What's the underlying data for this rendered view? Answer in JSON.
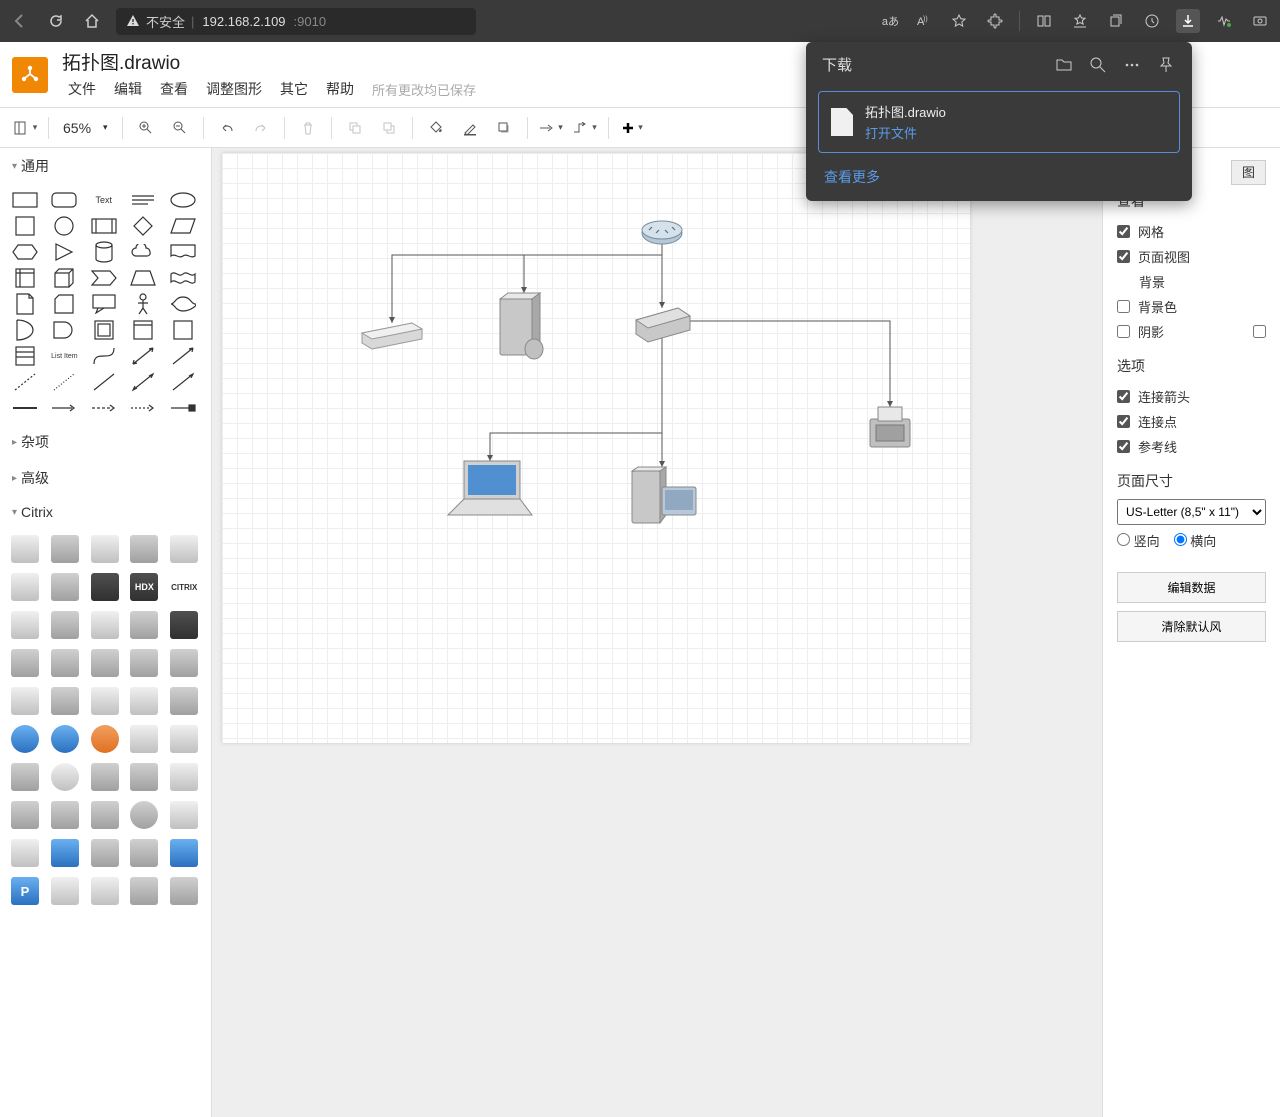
{
  "browser": {
    "insecure_label": "不安全",
    "url_host": "192.168.2.109",
    "url_port": ":9010",
    "lang_indicator": "aあ"
  },
  "app": {
    "doc_title": "拓扑图.drawio",
    "menus": [
      "文件",
      "编辑",
      "查看",
      "调整图形",
      "其它",
      "帮助"
    ],
    "save_status": "所有更改均已保存"
  },
  "toolbar": {
    "zoom_value": "65%"
  },
  "sidebar_left": {
    "categories": [
      "通用",
      "杂项",
      "高级",
      "Citrix"
    ]
  },
  "right_panel": {
    "tab_label": "图",
    "view_title": "查看",
    "checks_view": [
      {
        "label": "网格",
        "checked": true
      },
      {
        "label": "页面视图",
        "checked": true
      }
    ],
    "bg_label": "背景",
    "checks_bg": [
      {
        "label": "背景色",
        "checked": false
      },
      {
        "label": "阴影",
        "checked": false
      }
    ],
    "options_title": "选项",
    "checks_options": [
      {
        "label": "连接箭头",
        "checked": true
      },
      {
        "label": "连接点",
        "checked": true
      },
      {
        "label": "参考线",
        "checked": true
      }
    ],
    "pagesize_title": "页面尺寸",
    "pagesize_value": "US-Letter (8,5\" x 11\")",
    "orientation": {
      "portrait": "竖向",
      "landscape": "横向",
      "selected": "landscape"
    },
    "btn_edit_data": "编辑数据",
    "btn_clear_default": "清除默认风"
  },
  "download_popup": {
    "title": "下载",
    "file_name": "拓扑图.drawio",
    "open_file": "打开文件",
    "see_more": "查看更多"
  }
}
